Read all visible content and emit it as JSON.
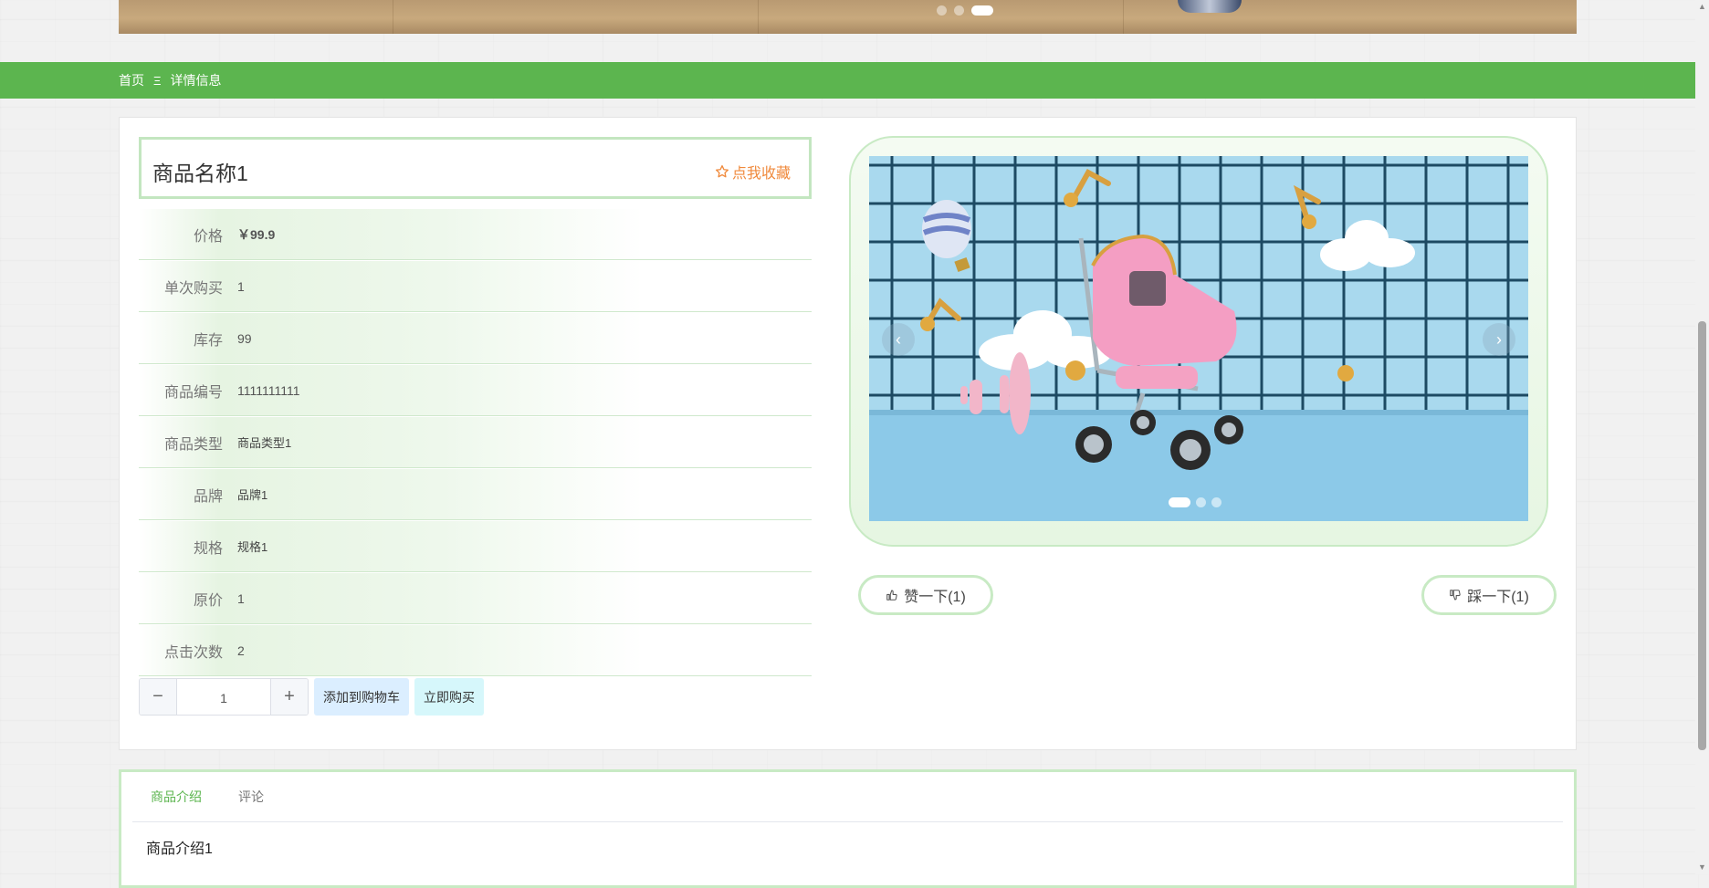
{
  "breadcrumb": {
    "home": "首页",
    "separator": "Ξ",
    "current": "详情信息"
  },
  "product": {
    "name": "商品名称1",
    "favorite_label": "点我收藏",
    "fields": [
      {
        "label": "价格",
        "value": "￥99.9"
      },
      {
        "label": "单次购买",
        "value": "1"
      },
      {
        "label": "库存",
        "value": "99"
      },
      {
        "label": "商品编号",
        "value": "1111111111"
      },
      {
        "label": "商品类型",
        "value": "商品类型1"
      },
      {
        "label": "品牌",
        "value": "品牌1"
      },
      {
        "label": "规格",
        "value": "规格1"
      },
      {
        "label": "原价",
        "value": "1"
      },
      {
        "label": "点击次数",
        "value": "2"
      }
    ]
  },
  "purchase": {
    "quantity": "1",
    "minus": "−",
    "plus": "+",
    "add_to_cart": "添加到购物车",
    "buy_now": "立即购买"
  },
  "gallery": {
    "prev": "‹",
    "next": "›",
    "slide_count": 3,
    "active_slide": 1,
    "image_subject": "pink-baby-stroller"
  },
  "banner": {
    "slide_count": 3,
    "active_slide": 3
  },
  "votes": {
    "like_label": "赞一下(1)",
    "dislike_label": "踩一下(1)"
  },
  "tabs": {
    "intro": "商品介绍",
    "comments": "评论",
    "active": "商品介绍"
  },
  "description": "商品介绍1",
  "colors": {
    "accent": "#5cb54f",
    "favorite": "#f08a3c",
    "border_green": "#c8eac4"
  }
}
